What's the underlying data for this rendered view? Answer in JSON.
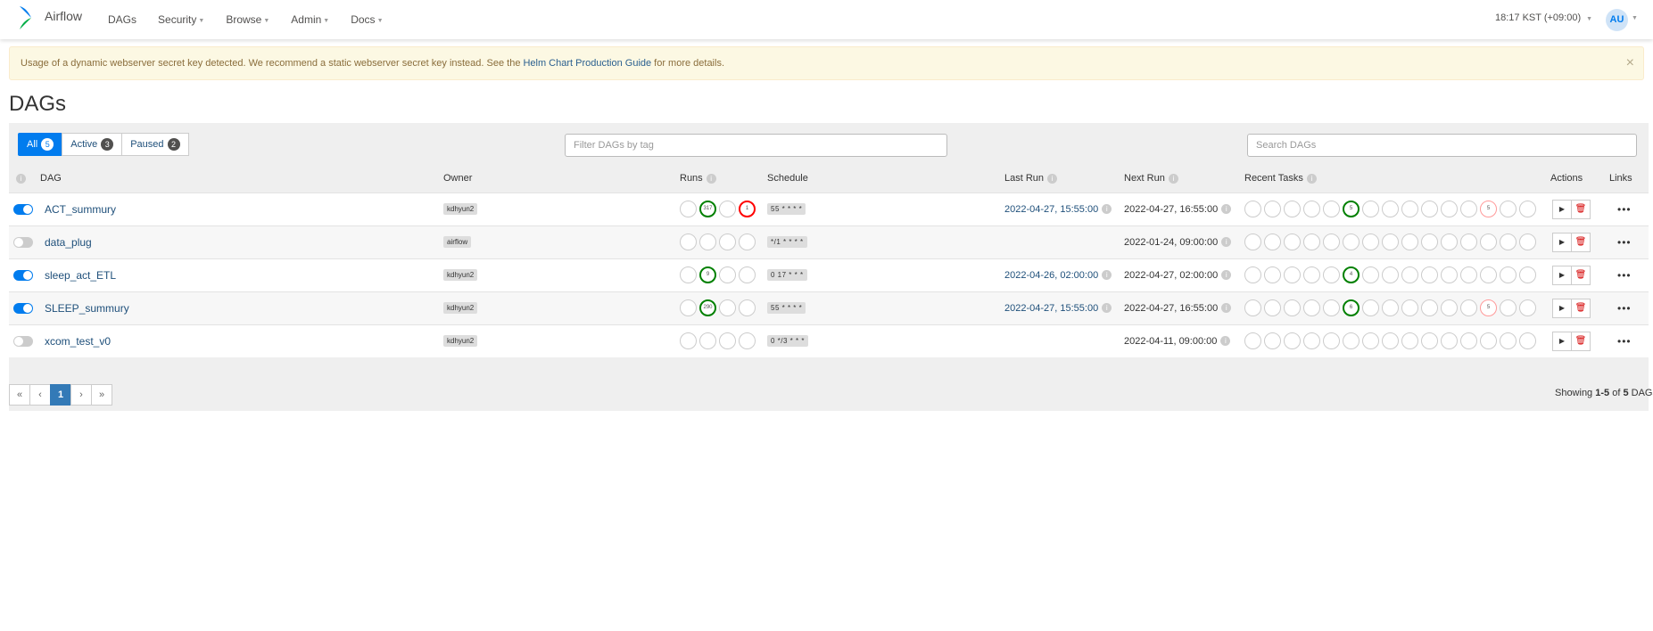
{
  "header": {
    "brand": "Airflow",
    "nav": [
      "DAGs",
      "Security",
      "Browse",
      "Admin",
      "Docs"
    ],
    "clock": "18:17 KST (+09:00)",
    "avatar": "AU"
  },
  "alert": {
    "text_before": "Usage of a dynamic webserver secret key detected. We recommend a static webserver secret key instead. See the",
    "link": "Helm Chart Production Guide",
    "text_after": "for more details.",
    "close": "×"
  },
  "page_title": "DAGs",
  "tabs": [
    {
      "label": "All",
      "count": "5"
    },
    {
      "label": "Active",
      "count": "3"
    },
    {
      "label": "Paused",
      "count": "2"
    }
  ],
  "filter_placeholder": "Filter DAGs by tag",
  "search_placeholder": "Search DAGs",
  "columns": {
    "dag": "DAG",
    "owner": "Owner",
    "runs": "Runs",
    "schedule": "Schedule",
    "last_run": "Last Run",
    "next_run": "Next Run",
    "recent_tasks": "Recent Tasks",
    "actions": "Actions",
    "links": "Links"
  },
  "rows": [
    {
      "name": "ACT_summury",
      "active": true,
      "owner": "kdhyun2",
      "schedule": "55 * * * *",
      "runs": [
        "",
        "317",
        "",
        "1"
      ],
      "last_run": "2022-04-27, 15:55:00",
      "next_run": "2022-04-27, 16:55:00",
      "tasks": {
        "5": "5",
        "12": "5"
      }
    },
    {
      "name": "data_plug",
      "active": false,
      "owner": "airflow",
      "schedule": "*/1 * * * *",
      "runs": [
        "",
        "",
        "",
        ""
      ],
      "last_run": "",
      "next_run": "2022-01-24, 09:00:00",
      "tasks": {}
    },
    {
      "name": "sleep_act_ETL",
      "active": true,
      "owner": "kdhyun2",
      "schedule": "0 17 * * *",
      "runs": [
        "",
        "9",
        "",
        ""
      ],
      "last_run": "2022-04-26, 02:00:00",
      "next_run": "2022-04-27, 02:00:00",
      "tasks": {
        "5": "4"
      }
    },
    {
      "name": "SLEEP_summury",
      "active": true,
      "owner": "kdhyun2",
      "schedule": "55 * * * *",
      "runs": [
        "",
        "290",
        "",
        ""
      ],
      "last_run": "2022-04-27, 15:55:00",
      "next_run": "2022-04-27, 16:55:00",
      "tasks": {
        "5": "6",
        "12": "5"
      }
    },
    {
      "name": "xcom_test_v0",
      "active": false,
      "owner": "kdhyun2",
      "schedule": "0 */3 * * *",
      "runs": [
        "",
        "",
        "",
        ""
      ],
      "last_run": "",
      "next_run": "2022-04-11, 09:00:00",
      "tasks": {}
    }
  ],
  "pagination": {
    "first": "«",
    "prev": "‹",
    "current": "1",
    "next": "›",
    "last": "»"
  },
  "showing": {
    "prefix": "Showing",
    "range": "1-5",
    "of": "of",
    "total": "5",
    "suffix": "DAGs"
  },
  "colors": {
    "accent": "#017cee",
    "success": "#008000",
    "failed": "#ff0000",
    "up_for_retry": "#ff9a9a"
  },
  "icons": {
    "trigger": "play-icon",
    "delete": "trash-icon",
    "links": "more-dots-icon",
    "info": "info-icon"
  }
}
